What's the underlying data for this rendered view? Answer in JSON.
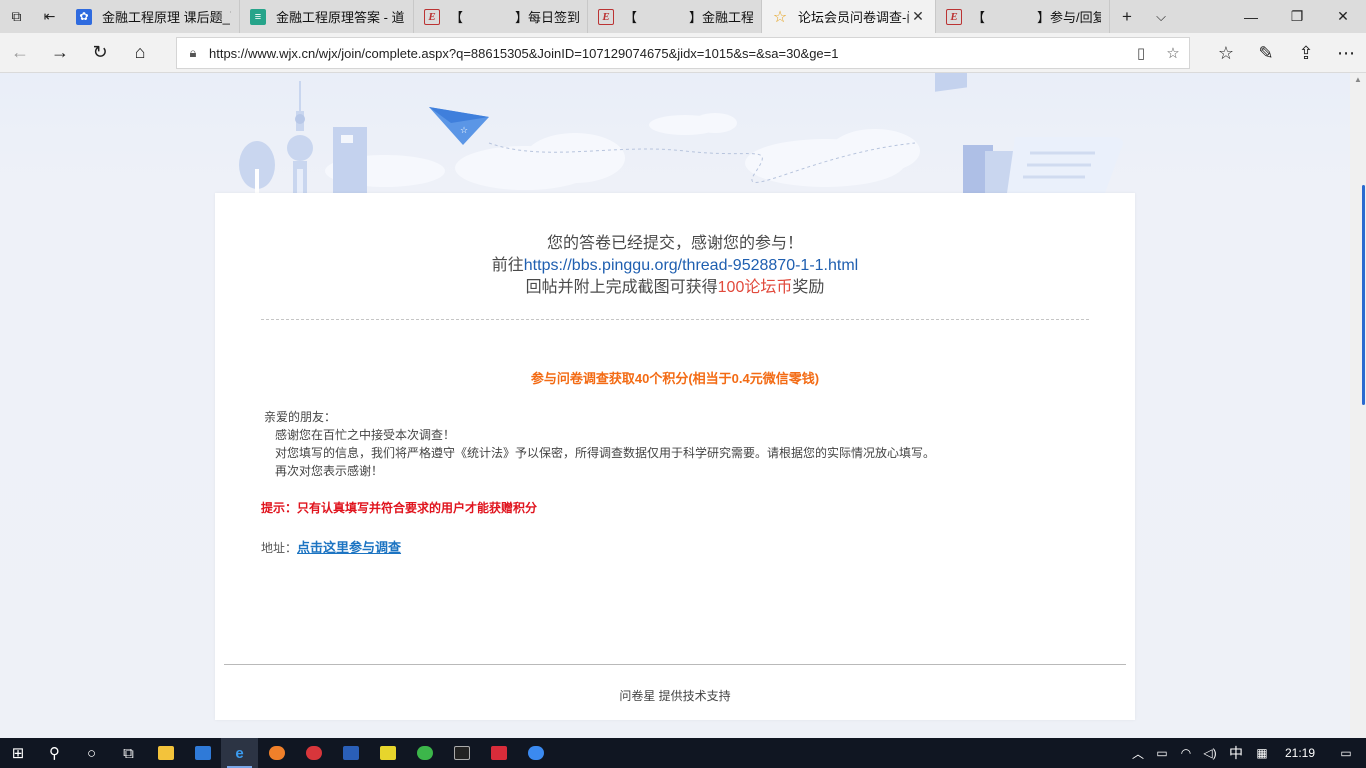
{
  "browser": {
    "tabs": [
      {
        "title": "金融工程原理 课后题_百",
        "icon": "baidu-paw-icon",
        "active": false
      },
      {
        "title": "金融工程原理答案 - 道客",
        "icon": "doc-icon",
        "active": false
      },
      {
        "title": "【　　　　】每日签到 - 经",
        "icon": "forum-e-icon",
        "active": false
      },
      {
        "title": "【　　　　】金融工程原理",
        "icon": "forum-e-icon",
        "active": false
      },
      {
        "title": "论坛会员问卷调查-问卷",
        "icon": "star-icon",
        "active": true
      },
      {
        "title": "【　　　　】参与/回复主",
        "icon": "forum-e-icon",
        "active": false
      }
    ],
    "url": "https://www.wjx.cn/wjx/join/complete.aspx?q=88615305&JoinID=107129074675&jidx=1015&s=&sa=30&ge=1"
  },
  "page": {
    "line1": "您的答卷已经提交，感谢您的参与！",
    "line2_prefix": "前往",
    "line2_link": "https://bbs.pinggu.org/thread-9528870-1-1.html",
    "line3_prefix": "回帖并附上完成截图可获得",
    "line3_reward": "100论坛币",
    "line3_suffix": "奖励",
    "promo_title": "参与问卷调查获取40个积分(相当于0.4元微信零钱)",
    "letter_greeting": "亲爱的朋友：",
    "letter_p1": "感谢您在百忙之中接受本次调查！",
    "letter_p2": "对您填写的信息，我们将严格遵守《统计法》予以保密，所得调查数据仅用于科学研究需要。请根据您的实际情况放心填写。",
    "letter_p3": "再次对您表示感谢！",
    "tip": "提示：只有认真填写并符合要求的用户才能获赠积分",
    "address_label": "地址：",
    "address_link": "点击这里参与调查",
    "footer": "问卷星 提供技术支持"
  },
  "colors": {
    "link_blue": "#1f5fb0",
    "reward_red": "#e14a3c",
    "promo_orange": "#f36b14",
    "tip_red": "#e0141e"
  },
  "taskbar": {
    "ime": "中",
    "clock": "21:19"
  }
}
